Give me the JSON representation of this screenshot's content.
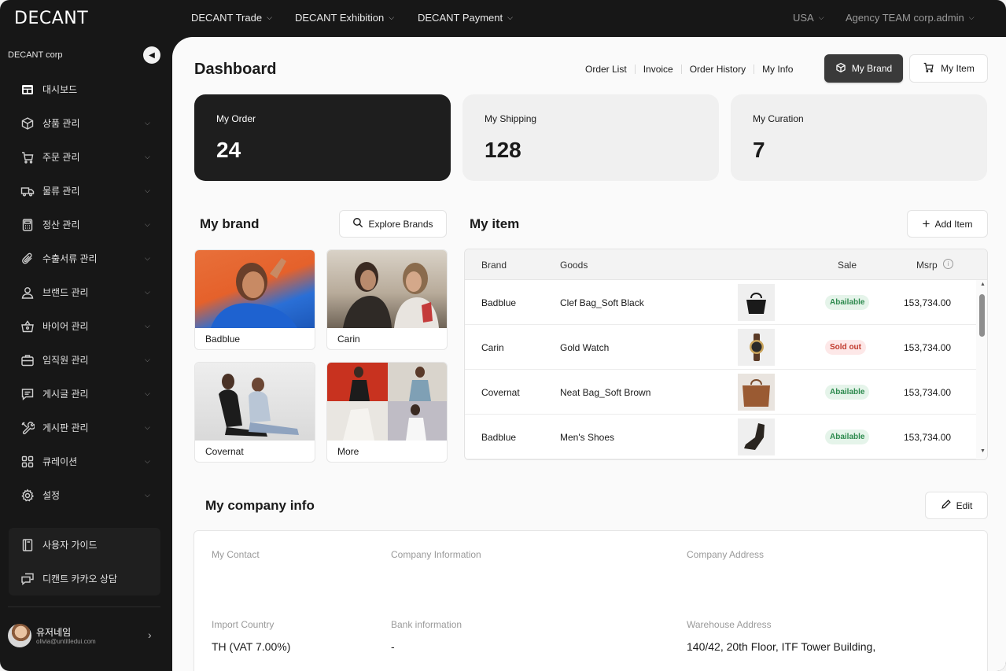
{
  "app": {
    "logo": "DECANT"
  },
  "topnav": {
    "items": [
      {
        "label": "DECANT Trade"
      },
      {
        "label": "DECANT Exhibition"
      },
      {
        "label": "DECANT Payment"
      }
    ],
    "region": "USA",
    "account": "Agency TEAM corp.admin"
  },
  "sidebar": {
    "company": "DECANT corp",
    "items": [
      {
        "label": "대시보드",
        "icon": "dashboard-icon"
      },
      {
        "label": "상품 관리",
        "icon": "box-icon"
      },
      {
        "label": "주문 관리",
        "icon": "cart-icon"
      },
      {
        "label": "물류 관리",
        "icon": "truck-icon"
      },
      {
        "label": "정산 관리",
        "icon": "calculator-icon"
      },
      {
        "label": "수출서류 관리",
        "icon": "paperclip-icon"
      },
      {
        "label": "브랜드 관리",
        "icon": "person-icon"
      },
      {
        "label": "바이어 관리",
        "icon": "basket-icon"
      },
      {
        "label": "임직원 관리",
        "icon": "briefcase-icon"
      },
      {
        "label": "게시글 관리",
        "icon": "message-icon"
      },
      {
        "label": "게시판 관리",
        "icon": "tools-icon"
      },
      {
        "label": "큐레이션",
        "icon": "grid-icon"
      },
      {
        "label": "설정",
        "icon": "gear-icon"
      }
    ],
    "guide": [
      {
        "label": "사용자 가이드",
        "icon": "book-icon"
      },
      {
        "label": "디캔트 카카오 상담",
        "icon": "chat-icon"
      }
    ],
    "user": {
      "name": "유저네임",
      "email": "olivia@untitledui.com"
    }
  },
  "main": {
    "title": "Dashboard",
    "quick_links": [
      "Order List",
      "Invoice",
      "Order History",
      "My Info"
    ],
    "my_brand_button": "My Brand",
    "my_item_button": "My Item",
    "stats": [
      {
        "label": "My Order",
        "value": "24"
      },
      {
        "label": "My Shipping",
        "value": "128"
      },
      {
        "label": "My Curation",
        "value": "7"
      }
    ],
    "brand_section": {
      "title": "My brand",
      "explore": "Explore Brands",
      "cards": [
        {
          "name": "Badblue"
        },
        {
          "name": "Carin"
        },
        {
          "name": "Covernat"
        },
        {
          "name": "More"
        }
      ]
    },
    "item_section": {
      "title": "My item",
      "add": "Add Item",
      "columns": [
        "Brand",
        "Goods",
        "Sale",
        "Msrp"
      ],
      "rows": [
        {
          "brand": "Badblue",
          "goods": "Clef Bag_Soft Black",
          "sale": "Abailable",
          "msrp": "153,734.00",
          "status": "ok"
        },
        {
          "brand": "Carin",
          "goods": "Gold Watch",
          "sale": "Sold out",
          "msrp": "153,734.00",
          "status": "sold"
        },
        {
          "brand": "Covernat",
          "goods": "Neat Bag_Soft Brown",
          "sale": "Abailable",
          "msrp": "153,734.00",
          "status": "ok"
        },
        {
          "brand": "Badblue",
          "goods": "Men's Shoes",
          "sale": "Abailable",
          "msrp": "153,734.00",
          "status": "ok"
        }
      ]
    },
    "company_section": {
      "title": "My company info",
      "edit": "Edit",
      "labels": {
        "contact": "My Contact",
        "company": "Company Information",
        "address": "Company Address",
        "import_country": "Import Country",
        "bank": "Bank information",
        "warehouse": "Warehouse Address"
      },
      "values": {
        "import_country": "TH (VAT 7.00%)",
        "bank": "-",
        "warehouse": "140/42, 20th Floor, ITF Tower Building,"
      }
    }
  }
}
